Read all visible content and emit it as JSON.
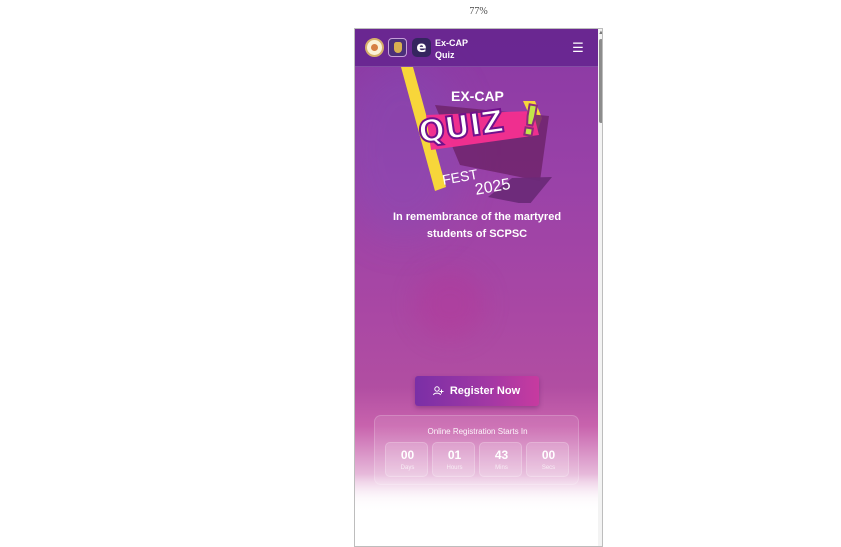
{
  "zoom": {
    "level": "77%"
  },
  "header": {
    "brand_line_1": "Ex-CAP",
    "brand_line_2": "Quiz",
    "logos": [
      "college-logo-icon",
      "crest-logo-icon",
      "excap-e-logo-icon"
    ],
    "menu_icon": "menu-icon"
  },
  "hero": {
    "logo_small": "EX-CAP",
    "logo_large": "QUIZ",
    "logo_fest": "FEST",
    "logo_year": "2025",
    "remembrance": "In remembrance of the martyred students of SCPSC"
  },
  "registration": {
    "button_label": "Register Now",
    "icon": "user-plus-icon"
  },
  "countdown": {
    "label": "Online Registration Starts In",
    "items": [
      {
        "value": "00",
        "unit": "Days"
      },
      {
        "value": "01",
        "unit": "Hours"
      },
      {
        "value": "43",
        "unit": "Mins"
      },
      {
        "value": "00",
        "unit": "Secs"
      }
    ]
  },
  "colors": {
    "navbar": "#6D2794",
    "hero_background": "#A947A4",
    "primary_button": "#8A33A8",
    "accent_yellow": "#F7D63A",
    "accent_pink": "#E1288D"
  }
}
